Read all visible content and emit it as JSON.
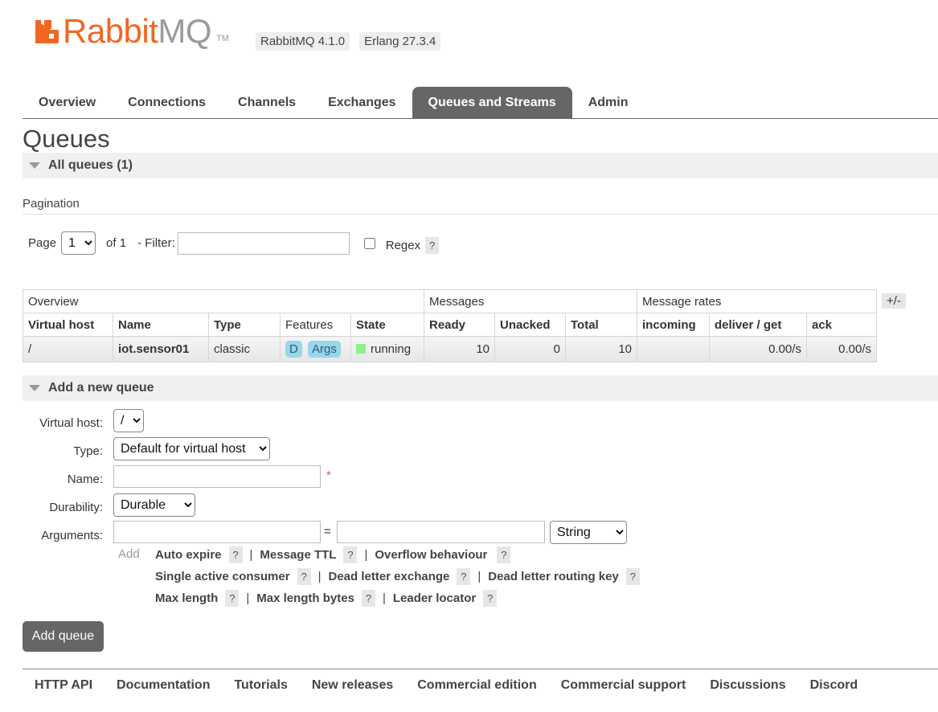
{
  "header": {
    "logo_text_rabbit": "Rabbit",
    "logo_text_mq": "MQ",
    "logo_tm": "TM",
    "version_badge": "RabbitMQ 4.1.0",
    "erlang_badge": "Erlang 27.3.4",
    "brand_color": "#f26622"
  },
  "tabs": [
    {
      "label": "Overview"
    },
    {
      "label": "Connections"
    },
    {
      "label": "Channels"
    },
    {
      "label": "Exchanges"
    },
    {
      "label": "Queues and Streams",
      "active": true
    },
    {
      "label": "Admin"
    }
  ],
  "page_title": "Queues",
  "all_queues": {
    "label": "All queues (1)"
  },
  "pagination": {
    "section_label": "Pagination",
    "page_label": "Page",
    "page_value": "1",
    "of_label": "of 1",
    "filter_label": "- Filter:",
    "filter_value": "",
    "regex_label": "Regex",
    "help": "?"
  },
  "table": {
    "groups": [
      "Overview",
      "Messages",
      "Message rates"
    ],
    "plus_minus": "+/-",
    "columns": [
      "Virtual host",
      "Name",
      "Type",
      "Features",
      "State",
      "Ready",
      "Unacked",
      "Total",
      "incoming",
      "deliver / get",
      "ack"
    ],
    "rows": [
      {
        "vhost": "/",
        "name": "iot.sensor01",
        "type": "classic",
        "features": [
          "D",
          "Args"
        ],
        "state": "running",
        "ready": "10",
        "unacked": "0",
        "total": "10",
        "incoming": "",
        "deliver_get": "0.00/s",
        "ack": "0.00/s"
      }
    ]
  },
  "add_queue": {
    "section_label": "Add a new queue",
    "vhost_label": "Virtual host:",
    "vhost_value": "/",
    "type_label": "Type:",
    "type_value": "Default for virtual host",
    "name_label": "Name:",
    "name_value": "",
    "required_mark": "*",
    "durability_label": "Durability:",
    "durability_value": "Durable",
    "arguments_label": "Arguments:",
    "equals": "=",
    "arg_type_value": "String",
    "add_label": "Add",
    "arg_links_row1": [
      "Auto expire",
      "Message TTL",
      "Overflow behaviour"
    ],
    "arg_links_row2": [
      "Single active consumer",
      "Dead letter exchange",
      "Dead letter routing key"
    ],
    "arg_links_row3": [
      "Max length",
      "Max length bytes",
      "Leader locator"
    ],
    "separator": "|",
    "submit_label": "Add queue"
  },
  "footer": [
    "HTTP API",
    "Documentation",
    "Tutorials",
    "New releases",
    "Commercial edition",
    "Commercial support",
    "Discussions",
    "Discord"
  ]
}
